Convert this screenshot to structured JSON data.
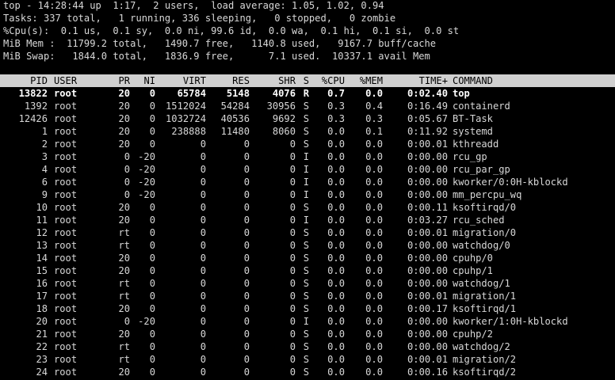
{
  "summary": {
    "line1": "top - 14:28:44 up  1:17,  2 users,  load average: 1.05, 1.02, 0.94",
    "line2": "Tasks: 337 total,   1 running, 336 sleeping,   0 stopped,   0 zombie",
    "line3": "%Cpu(s):  0.1 us,  0.1 sy,  0.0 ni, 99.6 id,  0.0 wa,  0.1 hi,  0.1 si,  0.0 st",
    "line4": "MiB Mem :  11799.2 total,   1490.7 free,   1140.8 used,   9167.7 buff/cache",
    "line5": "MiB Swap:   1844.0 total,   1836.9 free,      7.1 used.  10337.1 avail Mem"
  },
  "columns": {
    "pid": "PID",
    "user": "USER",
    "pr": "PR",
    "ni": "NI",
    "virt": "VIRT",
    "res": "RES",
    "shr": "SHR",
    "s": "S",
    "cpu": "%CPU",
    "mem": "%MEM",
    "time": "TIME+",
    "command": "COMMAND"
  },
  "processes": [
    {
      "pid": "13822",
      "user": "root",
      "pr": "20",
      "ni": "0",
      "virt": "65784",
      "res": "5148",
      "shr": "4076",
      "s": "R",
      "cpu": "0.7",
      "mem": "0.0",
      "time": "0:02.40",
      "command": "top",
      "highlight": true
    },
    {
      "pid": "1392",
      "user": "root",
      "pr": "20",
      "ni": "0",
      "virt": "1512024",
      "res": "54284",
      "shr": "30956",
      "s": "S",
      "cpu": "0.3",
      "mem": "0.4",
      "time": "0:16.49",
      "command": "containerd"
    },
    {
      "pid": "12426",
      "user": "root",
      "pr": "20",
      "ni": "0",
      "virt": "1032724",
      "res": "40536",
      "shr": "9692",
      "s": "S",
      "cpu": "0.3",
      "mem": "0.3",
      "time": "0:05.67",
      "command": "BT-Task"
    },
    {
      "pid": "1",
      "user": "root",
      "pr": "20",
      "ni": "0",
      "virt": "238888",
      "res": "11480",
      "shr": "8060",
      "s": "S",
      "cpu": "0.0",
      "mem": "0.1",
      "time": "0:11.92",
      "command": "systemd"
    },
    {
      "pid": "2",
      "user": "root",
      "pr": "20",
      "ni": "0",
      "virt": "0",
      "res": "0",
      "shr": "0",
      "s": "S",
      "cpu": "0.0",
      "mem": "0.0",
      "time": "0:00.01",
      "command": "kthreadd"
    },
    {
      "pid": "3",
      "user": "root",
      "pr": "0",
      "ni": "-20",
      "virt": "0",
      "res": "0",
      "shr": "0",
      "s": "I",
      "cpu": "0.0",
      "mem": "0.0",
      "time": "0:00.00",
      "command": "rcu_gp"
    },
    {
      "pid": "4",
      "user": "root",
      "pr": "0",
      "ni": "-20",
      "virt": "0",
      "res": "0",
      "shr": "0",
      "s": "I",
      "cpu": "0.0",
      "mem": "0.0",
      "time": "0:00.00",
      "command": "rcu_par_gp"
    },
    {
      "pid": "6",
      "user": "root",
      "pr": "0",
      "ni": "-20",
      "virt": "0",
      "res": "0",
      "shr": "0",
      "s": "I",
      "cpu": "0.0",
      "mem": "0.0",
      "time": "0:00.00",
      "command": "kworker/0:0H-kblockd"
    },
    {
      "pid": "9",
      "user": "root",
      "pr": "0",
      "ni": "-20",
      "virt": "0",
      "res": "0",
      "shr": "0",
      "s": "I",
      "cpu": "0.0",
      "mem": "0.0",
      "time": "0:00.00",
      "command": "mm_percpu_wq"
    },
    {
      "pid": "10",
      "user": "root",
      "pr": "20",
      "ni": "0",
      "virt": "0",
      "res": "0",
      "shr": "0",
      "s": "S",
      "cpu": "0.0",
      "mem": "0.0",
      "time": "0:00.11",
      "command": "ksoftirqd/0"
    },
    {
      "pid": "11",
      "user": "root",
      "pr": "20",
      "ni": "0",
      "virt": "0",
      "res": "0",
      "shr": "0",
      "s": "I",
      "cpu": "0.0",
      "mem": "0.0",
      "time": "0:03.27",
      "command": "rcu_sched"
    },
    {
      "pid": "12",
      "user": "root",
      "pr": "rt",
      "ni": "0",
      "virt": "0",
      "res": "0",
      "shr": "0",
      "s": "S",
      "cpu": "0.0",
      "mem": "0.0",
      "time": "0:00.01",
      "command": "migration/0"
    },
    {
      "pid": "13",
      "user": "root",
      "pr": "rt",
      "ni": "0",
      "virt": "0",
      "res": "0",
      "shr": "0",
      "s": "S",
      "cpu": "0.0",
      "mem": "0.0",
      "time": "0:00.00",
      "command": "watchdog/0"
    },
    {
      "pid": "14",
      "user": "root",
      "pr": "20",
      "ni": "0",
      "virt": "0",
      "res": "0",
      "shr": "0",
      "s": "S",
      "cpu": "0.0",
      "mem": "0.0",
      "time": "0:00.00",
      "command": "cpuhp/0"
    },
    {
      "pid": "15",
      "user": "root",
      "pr": "20",
      "ni": "0",
      "virt": "0",
      "res": "0",
      "shr": "0",
      "s": "S",
      "cpu": "0.0",
      "mem": "0.0",
      "time": "0:00.00",
      "command": "cpuhp/1"
    },
    {
      "pid": "16",
      "user": "root",
      "pr": "rt",
      "ni": "0",
      "virt": "0",
      "res": "0",
      "shr": "0",
      "s": "S",
      "cpu": "0.0",
      "mem": "0.0",
      "time": "0:00.00",
      "command": "watchdog/1"
    },
    {
      "pid": "17",
      "user": "root",
      "pr": "rt",
      "ni": "0",
      "virt": "0",
      "res": "0",
      "shr": "0",
      "s": "S",
      "cpu": "0.0",
      "mem": "0.0",
      "time": "0:00.01",
      "command": "migration/1"
    },
    {
      "pid": "18",
      "user": "root",
      "pr": "20",
      "ni": "0",
      "virt": "0",
      "res": "0",
      "shr": "0",
      "s": "S",
      "cpu": "0.0",
      "mem": "0.0",
      "time": "0:00.17",
      "command": "ksoftirqd/1"
    },
    {
      "pid": "20",
      "user": "root",
      "pr": "0",
      "ni": "-20",
      "virt": "0",
      "res": "0",
      "shr": "0",
      "s": "I",
      "cpu": "0.0",
      "mem": "0.0",
      "time": "0:00.00",
      "command": "kworker/1:0H-kblockd"
    },
    {
      "pid": "21",
      "user": "root",
      "pr": "20",
      "ni": "0",
      "virt": "0",
      "res": "0",
      "shr": "0",
      "s": "S",
      "cpu": "0.0",
      "mem": "0.0",
      "time": "0:00.00",
      "command": "cpuhp/2"
    },
    {
      "pid": "22",
      "user": "root",
      "pr": "rt",
      "ni": "0",
      "virt": "0",
      "res": "0",
      "shr": "0",
      "s": "S",
      "cpu": "0.0",
      "mem": "0.0",
      "time": "0:00.00",
      "command": "watchdog/2"
    },
    {
      "pid": "23",
      "user": "root",
      "pr": "rt",
      "ni": "0",
      "virt": "0",
      "res": "0",
      "shr": "0",
      "s": "S",
      "cpu": "0.0",
      "mem": "0.0",
      "time": "0:00.01",
      "command": "migration/2"
    },
    {
      "pid": "24",
      "user": "root",
      "pr": "20",
      "ni": "0",
      "virt": "0",
      "res": "0",
      "shr": "0",
      "s": "S",
      "cpu": "0.0",
      "mem": "0.0",
      "time": "0:00.16",
      "command": "ksoftirqd/2"
    }
  ],
  "colors": {
    "background": "#000000",
    "text": "#d8d8d8",
    "header_bar": "#d0d0d0",
    "header_text": "#000000",
    "highlight_text": "#ffffff"
  }
}
